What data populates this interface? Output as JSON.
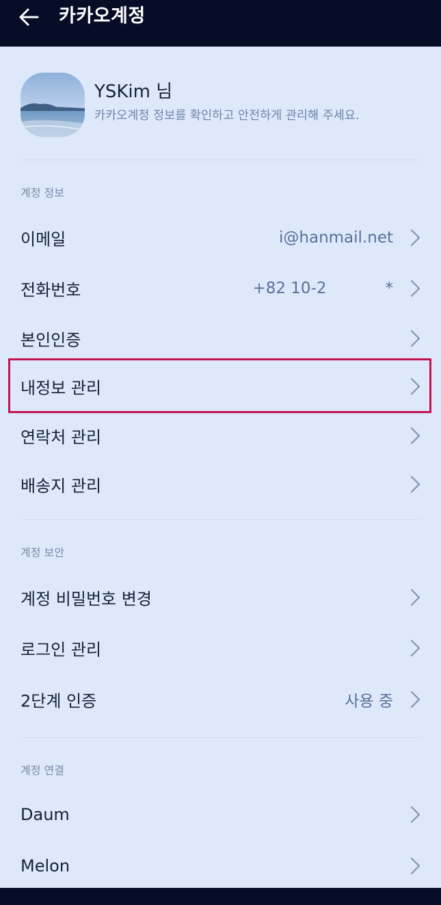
{
  "header": {
    "title": "카카오계정",
    "back_icon": "arrow-left-icon"
  },
  "profile": {
    "name": "YSKim 님",
    "description": "카카오계정 정보를 확인하고 안전하게 관리해 주세요."
  },
  "sections": {
    "account_info": {
      "title": "계정 정보",
      "items": [
        {
          "label": "이메일",
          "value": "i@hanmail.net"
        },
        {
          "label": "전화번호",
          "value": "+82 10-2"
        },
        {
          "label": "본인인증",
          "value": ""
        },
        {
          "label": "내정보 관리",
          "value": ""
        },
        {
          "label": "연락처 관리",
          "value": ""
        },
        {
          "label": "배송지 관리",
          "value": ""
        }
      ]
    },
    "account_security": {
      "title": "계정 보안",
      "items": [
        {
          "label": "계정 비밀번호 변경",
          "value": ""
        },
        {
          "label": "로그인 관리",
          "value": ""
        },
        {
          "label": "2단계 인증",
          "value": "사용 중"
        }
      ]
    },
    "account_link": {
      "title": "계정 연결",
      "items": [
        {
          "label": "Daum",
          "value": ""
        },
        {
          "label": "Melon",
          "value": ""
        }
      ]
    }
  },
  "phone_masked_tail": "*",
  "colors": {
    "header_bg": "#070d27",
    "page_bg": "#dde8fb",
    "highlight": "#c3124f",
    "value_text": "#5a7099"
  }
}
